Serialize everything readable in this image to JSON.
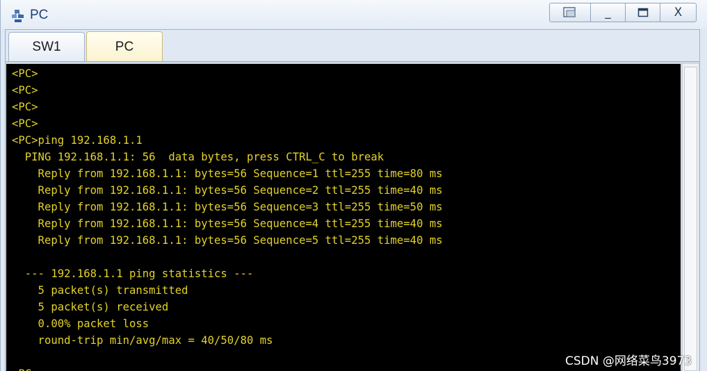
{
  "window": {
    "title": "PC",
    "icon": "network-pc-icon",
    "controls": {
      "restore": "⧉",
      "minimize": "_",
      "maximize": "☐",
      "close": "X"
    }
  },
  "tabs": [
    {
      "label": "SW1",
      "active": false
    },
    {
      "label": "PC",
      "active": true
    }
  ],
  "terminal": {
    "text_color": "#e3d22a",
    "background": "#000000",
    "lines": [
      "<PC>",
      "<PC>",
      "<PC>",
      "<PC>",
      "<PC>ping 192.168.1.1",
      "  PING 192.168.1.1: 56  data bytes, press CTRL_C to break",
      "    Reply from 192.168.1.1: bytes=56 Sequence=1 ttl=255 time=80 ms",
      "    Reply from 192.168.1.1: bytes=56 Sequence=2 ttl=255 time=40 ms",
      "    Reply from 192.168.1.1: bytes=56 Sequence=3 ttl=255 time=50 ms",
      "    Reply from 192.168.1.1: bytes=56 Sequence=4 ttl=255 time=40 ms",
      "    Reply from 192.168.1.1: bytes=56 Sequence=5 ttl=255 time=40 ms",
      "",
      "  --- 192.168.1.1 ping statistics ---",
      "    5 packet(s) transmitted",
      "    5 packet(s) received",
      "    0.00% packet loss",
      "    round-trip min/avg/max = 40/50/80 ms",
      "",
      "<PC>"
    ]
  },
  "watermark": "CSDN @网络菜鸟3973"
}
